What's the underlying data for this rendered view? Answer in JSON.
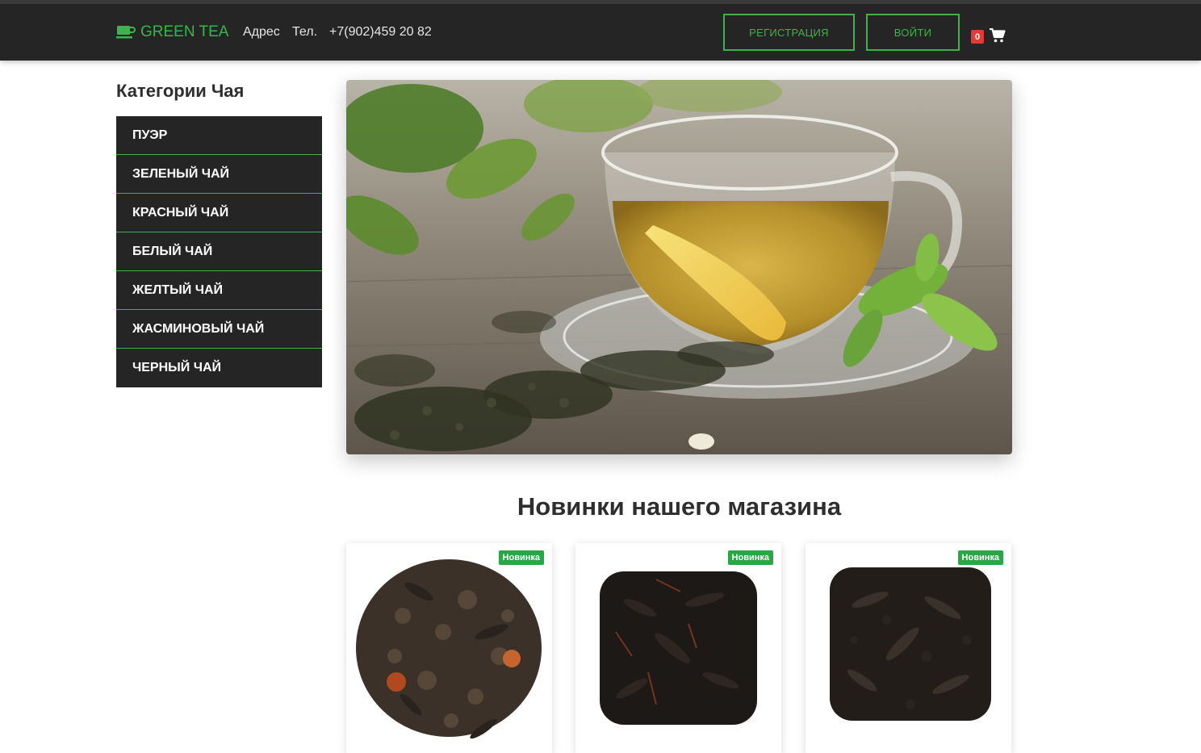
{
  "header": {
    "logo_text": "GREEN TEA",
    "logo_icon": "tea-cup-icon",
    "address_label": "Адрес",
    "phone_label": "Тел.",
    "phone_number": "+7(902)459 20 82",
    "register_label": "РЕГИСТРАЦИЯ",
    "login_label": "ВОЙТИ",
    "cart_count": "0",
    "cart_icon": "shopping-cart-icon"
  },
  "sidebar": {
    "title": "Категории Чая",
    "items": [
      {
        "label": "ПУЭР"
      },
      {
        "label": "ЗЕЛЕНЫЙ ЧАЙ"
      },
      {
        "label": "КРАСНЫЙ ЧАЙ"
      },
      {
        "label": "БЕЛЫЙ ЧАЙ"
      },
      {
        "label": "ЖЕЛТЫЙ ЧАЙ"
      },
      {
        "label": "ЖАСМИНОВЫЙ ЧАЙ"
      },
      {
        "label": "ЧЕРНЫЙ ЧАЙ"
      }
    ]
  },
  "main": {
    "section_title": "Новинки нашего магазина",
    "products": [
      {
        "badge": "Новинка"
      },
      {
        "badge": "Новинка"
      },
      {
        "badge": "Новинка"
      }
    ]
  },
  "colors": {
    "accent": "#3fb14d",
    "header_bg": "#252525",
    "badge_green": "#28a745",
    "cart_badge": "#e53935"
  }
}
